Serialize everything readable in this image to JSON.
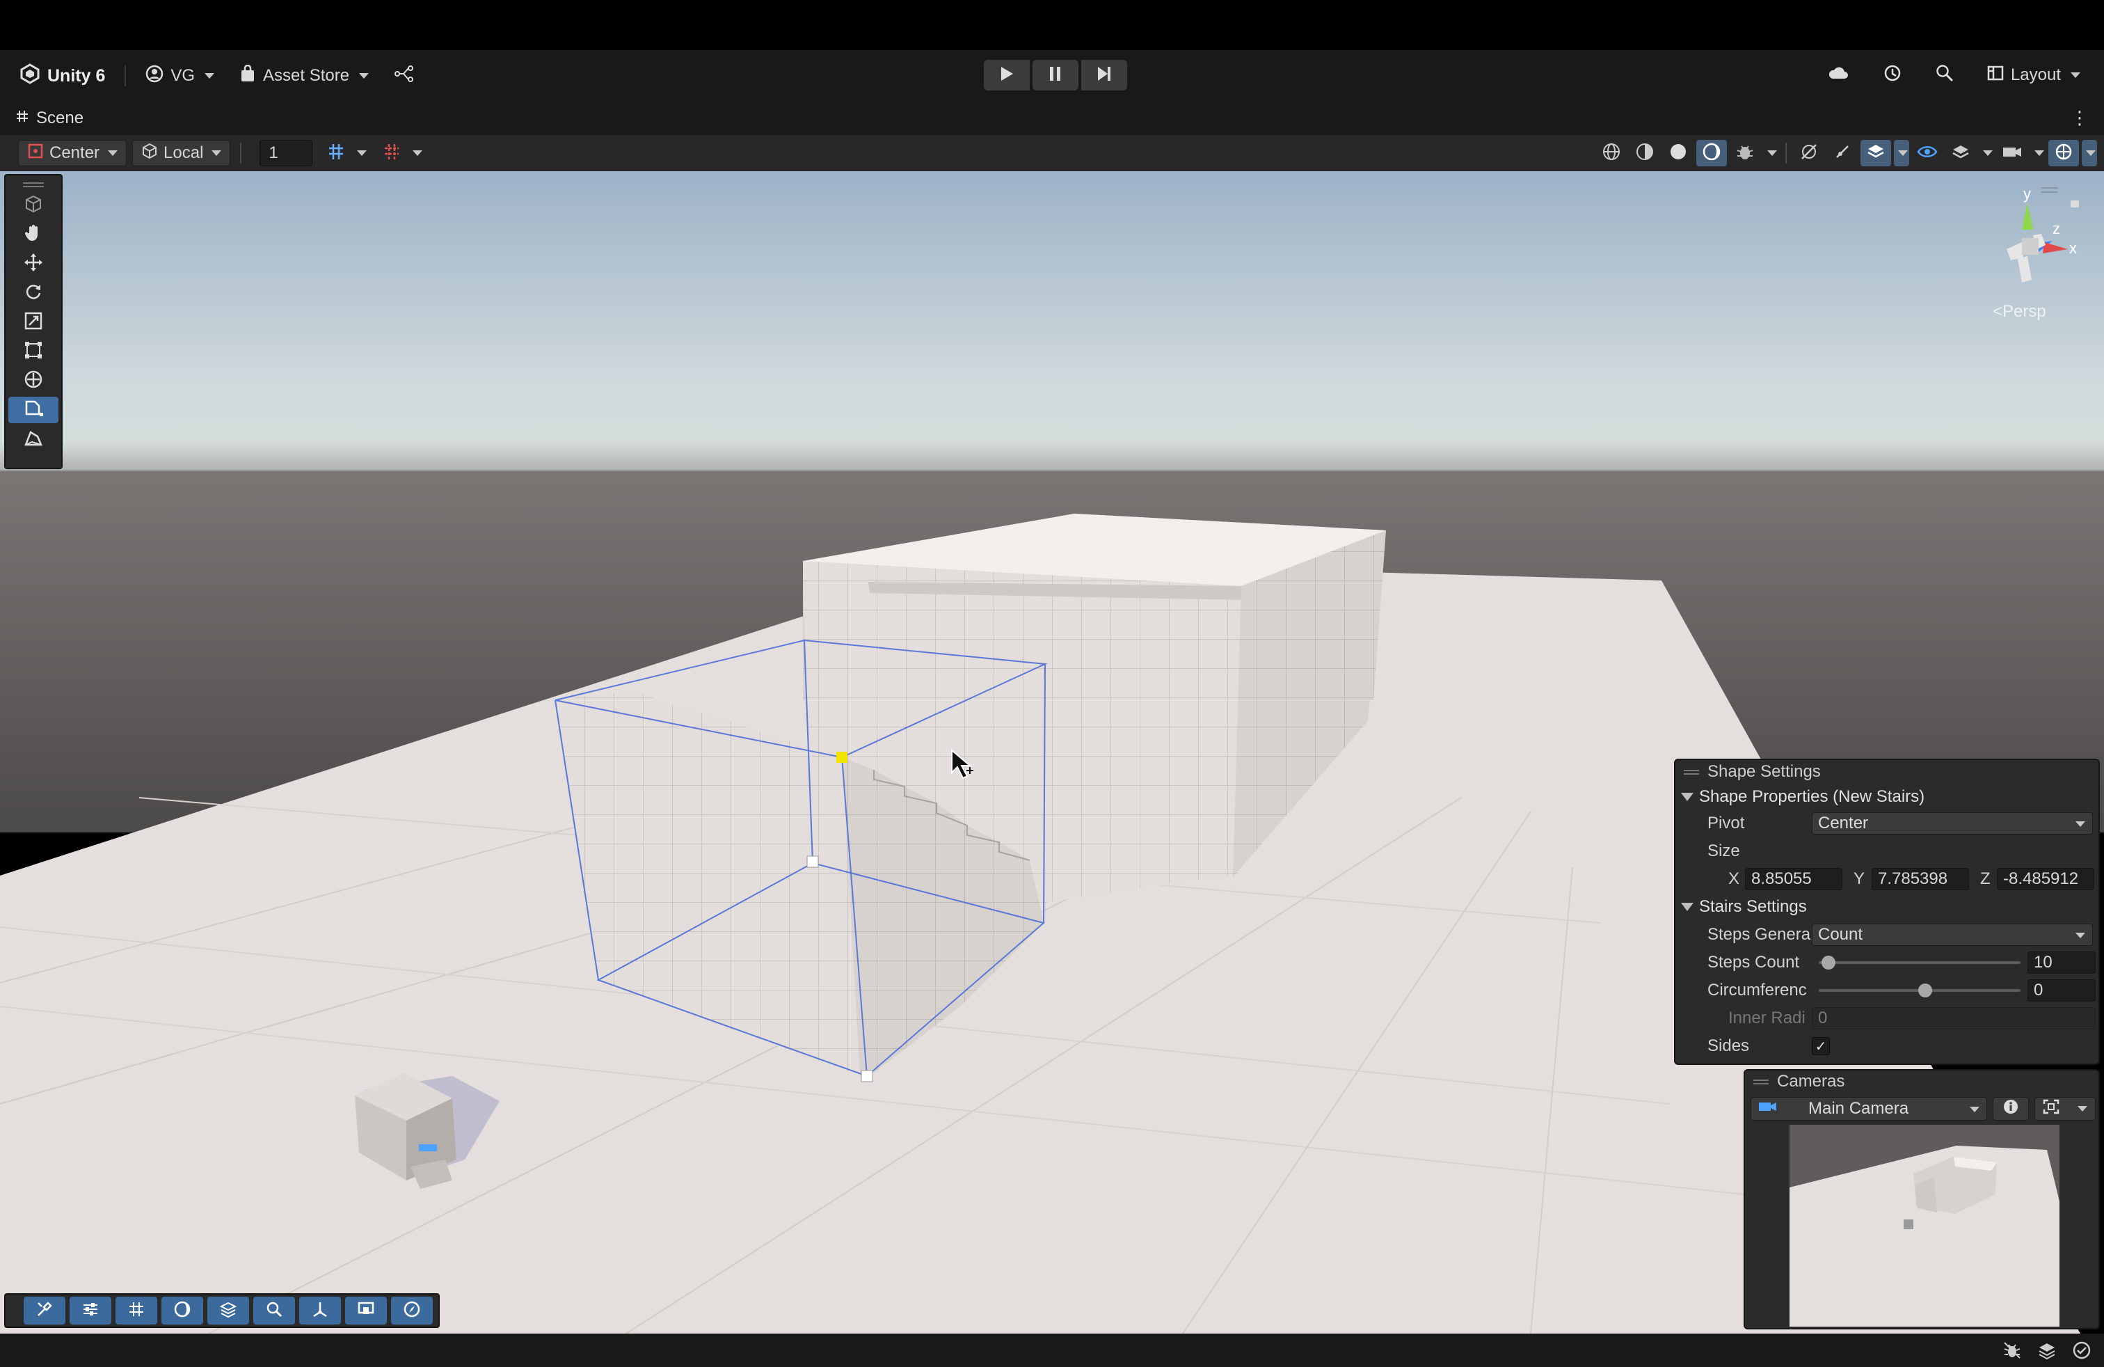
{
  "toolbar": {
    "app_name": "Unity 6",
    "account": "VG",
    "asset_store": "Asset Store",
    "layout": "Layout"
  },
  "scene_tab": {
    "label": "Scene"
  },
  "scene_toolbar": {
    "pivot_mode": "Center",
    "pivot_rotation": "Local",
    "grid_size": "1"
  },
  "viewport": {
    "projection_label": "Persp",
    "gizmo_axes": {
      "y": "y",
      "z": "z",
      "x": "x"
    }
  },
  "shape_settings": {
    "title": "Shape Settings",
    "properties_header": "Shape Properties (New Stairs)",
    "pivot_label": "Pivot",
    "pivot_value": "Center",
    "size_label": "Size",
    "size_x_label": "X",
    "size_x": "8.85055",
    "size_y_label": "Y",
    "size_y": "7.785398",
    "size_z_label": "Z",
    "size_z": "-8.485912",
    "stairs_header": "Stairs Settings",
    "steps_generation_label": "Steps Genera",
    "steps_generation_value": "Count",
    "steps_count_label": "Steps Count",
    "steps_count_value": "10",
    "steps_count_fraction": 0.02,
    "circumference_label": "Circumferenc",
    "circumference_value": "0",
    "circumference_fraction": 0.5,
    "inner_radius_label": "Inner Radi",
    "inner_radius_value": "0",
    "sides_label": "Sides",
    "sides_checked": true
  },
  "cameras": {
    "title": "Cameras",
    "selected_camera": "Main Camera"
  },
  "colors": {
    "accent": "#3f6ea3",
    "selection_outline": "#5a78d8",
    "handle_yellow": "#f2e600",
    "sky_top": "#a2b6c8",
    "ground": "#e4dfdc"
  }
}
